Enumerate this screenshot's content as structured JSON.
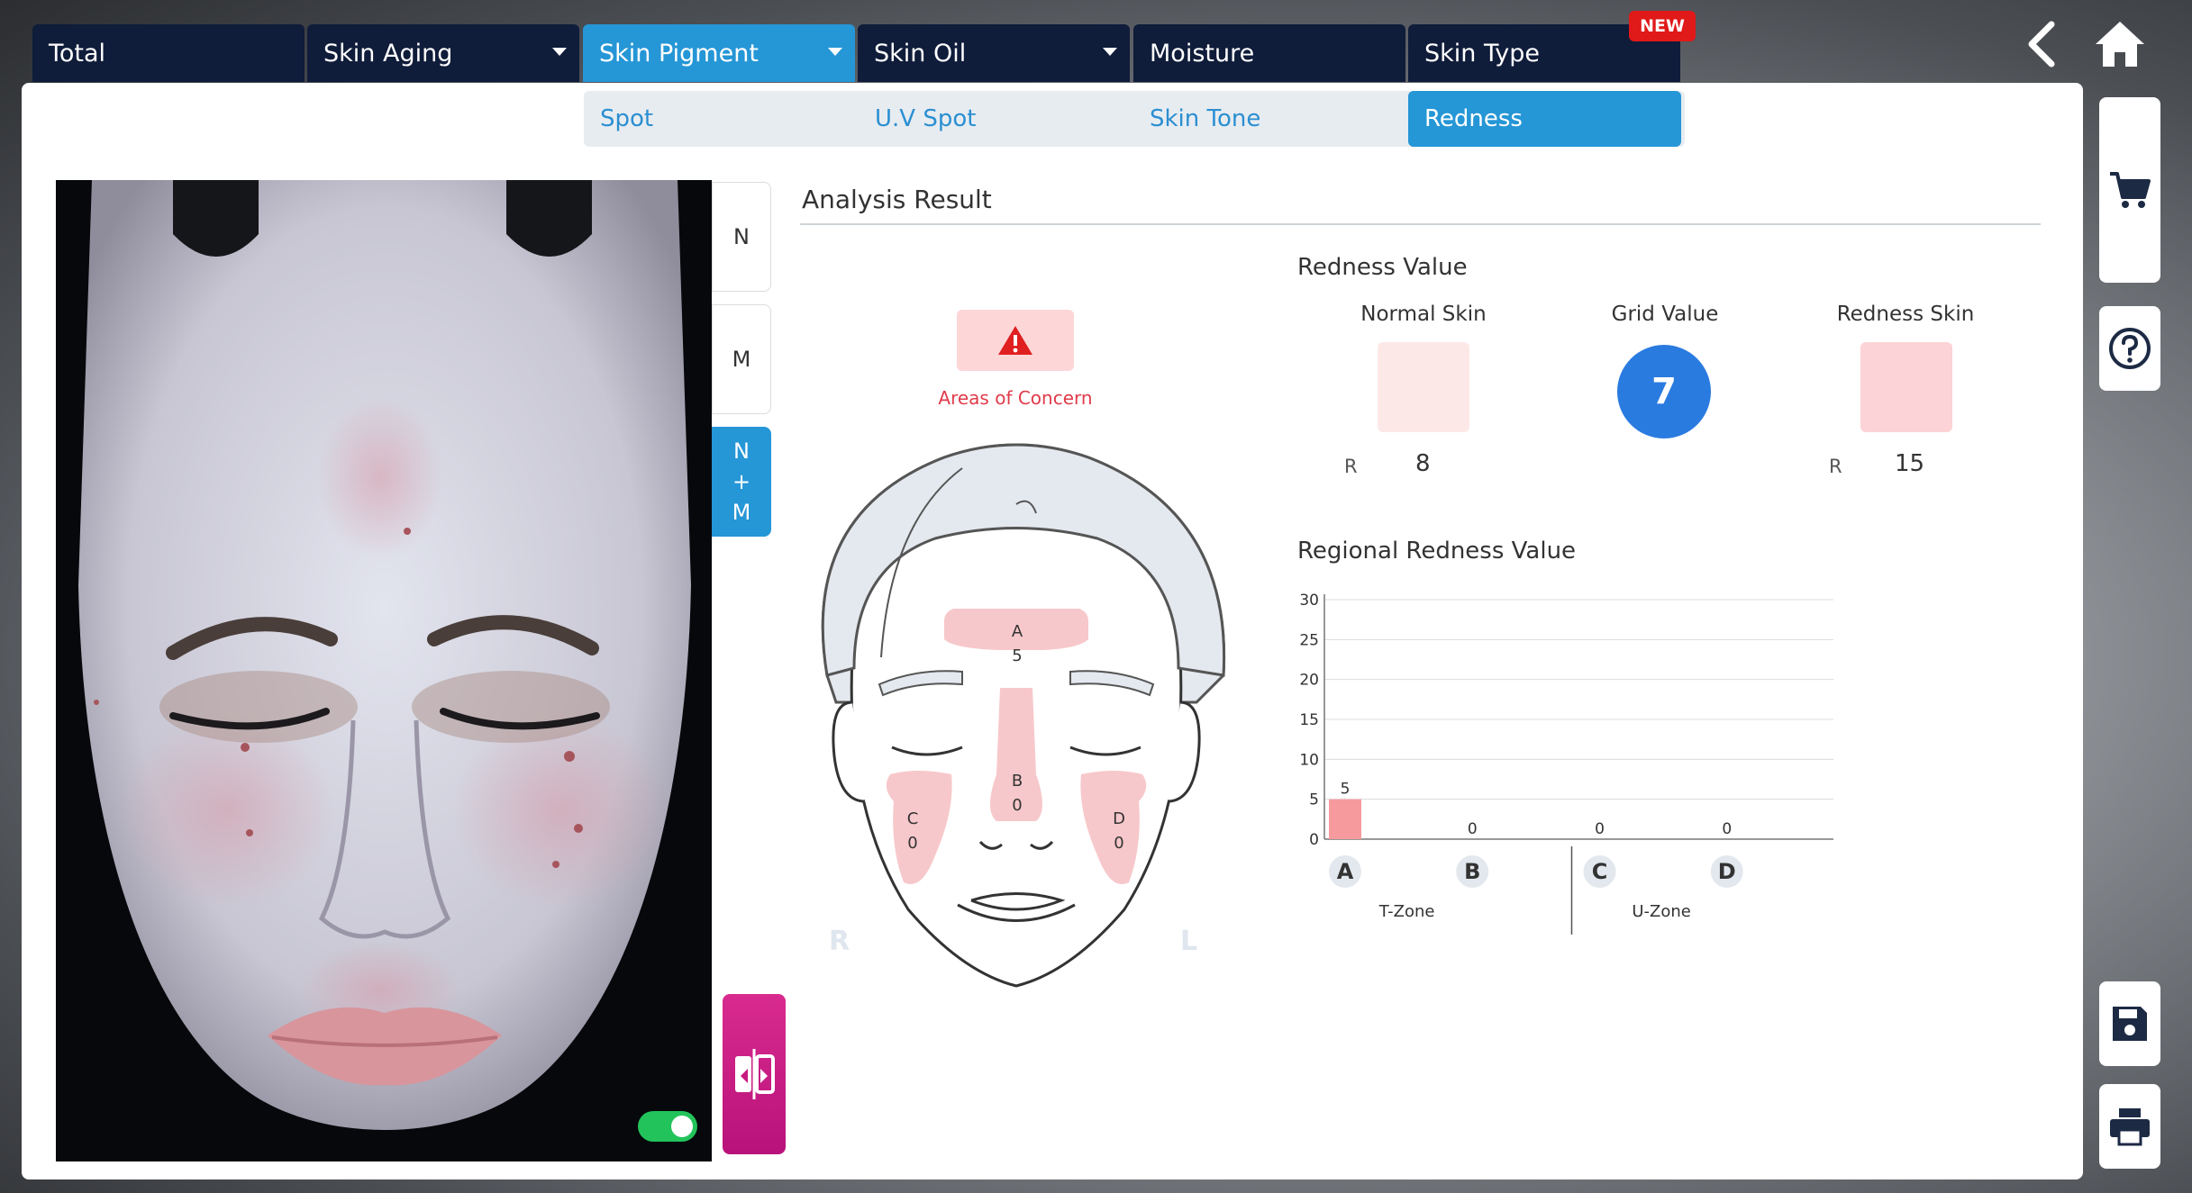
{
  "tabs": [
    {
      "label": "Total",
      "has_caret": false
    },
    {
      "label": "Skin Aging",
      "has_caret": true
    },
    {
      "label": "Skin Pigment",
      "has_caret": true,
      "active": true
    },
    {
      "label": "Skin Oil",
      "has_caret": true
    },
    {
      "label": "Moisture",
      "has_caret": false
    },
    {
      "label": "Skin Type",
      "has_caret": false
    }
  ],
  "new_badge": "NEW",
  "subtabs": [
    {
      "label": "Spot"
    },
    {
      "label": "U.V Spot"
    },
    {
      "label": "Skin Tone"
    },
    {
      "label": "Redness",
      "active": true
    }
  ],
  "modes": {
    "n": "N",
    "m": "M",
    "nm": [
      "N",
      "+",
      "M"
    ]
  },
  "analysis": {
    "title": "Analysis Result",
    "concern_label": "Areas of Concern",
    "face": {
      "zones": [
        {
          "letter": "A",
          "value": "5"
        },
        {
          "letter": "B",
          "value": "0"
        },
        {
          "letter": "C",
          "value": "0"
        },
        {
          "letter": "D",
          "value": "0"
        }
      ],
      "side_right": "R",
      "side_left": "L"
    },
    "redness_value": {
      "title": "Redness Value",
      "normal_label": "Normal Skin",
      "grid_label": "Grid Value",
      "redness_label": "Redness Skin",
      "normal_prefix": "R",
      "normal_value": "8",
      "grid_value": "7",
      "redness_prefix": "R",
      "redness_value": "15"
    },
    "regional_title": "Regional Redness Value"
  },
  "colors": {
    "tab_bg": "#0f1c3a",
    "active_blue": "#2596d6",
    "concern_red": "#e03b4a",
    "zone_pink": "#f7c8cb",
    "bar_pink": "#f79a9e",
    "grid_blue": "#2a7be0",
    "toggle_green": "#22c35a",
    "compare_magenta": "#c8197f"
  },
  "chart_data": {
    "type": "bar",
    "categories": [
      "A",
      "B",
      "C",
      "D"
    ],
    "values": [
      5,
      0,
      0,
      0
    ],
    "title": "Regional Redness Value",
    "xlabel": "",
    "ylabel": "",
    "ylim": [
      0,
      30
    ],
    "yticks": [
      0,
      5,
      10,
      15,
      20,
      25,
      30
    ],
    "groups": [
      {
        "name": "T-Zone",
        "categories": [
          "A",
          "B"
        ]
      },
      {
        "name": "U-Zone",
        "categories": [
          "C",
          "D"
        ]
      }
    ],
    "grid": true
  }
}
